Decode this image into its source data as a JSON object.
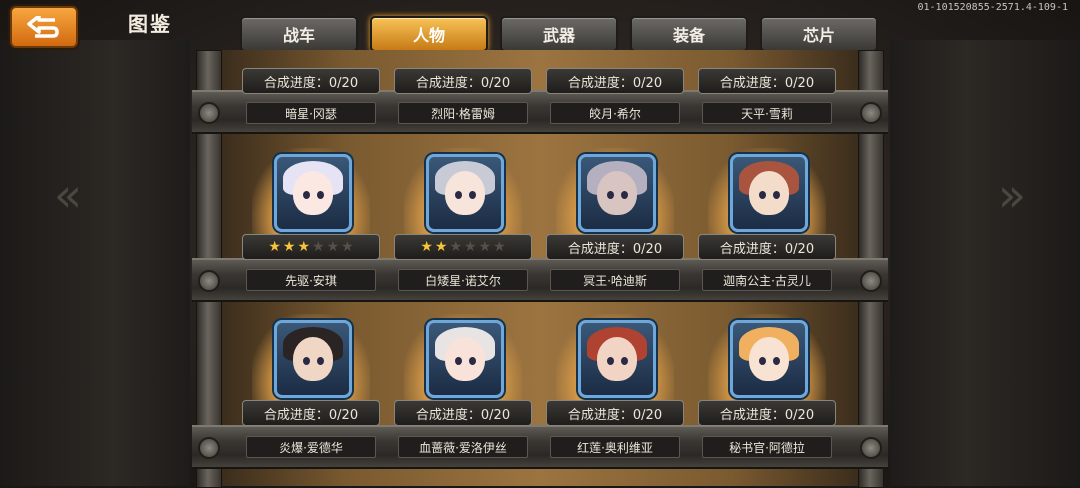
{
  "header": {
    "title": "图鉴",
    "version": "01-101520855-2571.4-109-1"
  },
  "tabs": [
    {
      "label": "战车",
      "active": false
    },
    {
      "label": "人物",
      "active": true
    },
    {
      "label": "武器",
      "active": false
    },
    {
      "label": "装备",
      "active": false
    },
    {
      "label": "芯片",
      "active": false
    }
  ],
  "rows": [
    {
      "cards": [
        {
          "progress": "合成进度：0/20",
          "name": "暗星·冈瑟"
        },
        {
          "progress": "合成进度：0/20",
          "name": "烈阳·格雷姆"
        },
        {
          "progress": "合成进度：0/20",
          "name": "皎月·希尔"
        },
        {
          "progress": "合成进度：0/20",
          "name": "天平·雪莉"
        }
      ]
    },
    {
      "cards": [
        {
          "stars": 3,
          "max_stars": 6,
          "name": "先驱·安琪",
          "portrait": {
            "hair": "#e6e4f4",
            "skin": "#fbe8e2"
          }
        },
        {
          "stars": 2,
          "max_stars": 6,
          "name": "白矮星·诺艾尔",
          "portrait": {
            "hair": "#c8cad6",
            "skin": "#f7e4da"
          }
        },
        {
          "progress": "合成进度：0/20",
          "name": "冥王·哈迪斯",
          "portrait": {
            "hair": "#b4b0c0",
            "skin": "#d8c4c0"
          }
        },
        {
          "progress": "合成进度：0/20",
          "name": "迦南公主·古灵儿",
          "portrait": {
            "hair": "#a8543e",
            "skin": "#f4dccb"
          }
        }
      ]
    },
    {
      "cards": [
        {
          "progress": "合成进度：0/20",
          "name": "炎爆·爱德华",
          "portrait": {
            "hair": "#2a2424",
            "skin": "#f0d6c4"
          }
        },
        {
          "progress": "合成进度：0/20",
          "name": "血蔷薇·爱洛伊丝",
          "portrait": {
            "hair": "#e8e4e4",
            "skin": "#f8e2da"
          }
        },
        {
          "progress": "合成进度：0/20",
          "name": "红莲·奥利维亚",
          "portrait": {
            "hair": "#b04232",
            "skin": "#f2d4c4"
          }
        },
        {
          "progress": "合成进度：0/20",
          "name": "秘书官·阿德拉",
          "portrait": {
            "hair": "#f0b060",
            "skin": "#f8e2d2"
          }
        }
      ]
    }
  ],
  "colors": {
    "active_tab": "#f0a83a",
    "portrait_border": "#6fa7d8",
    "star": "#f7c33a"
  }
}
